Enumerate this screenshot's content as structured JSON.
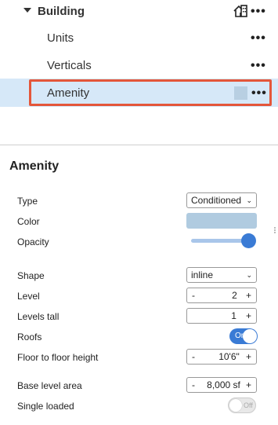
{
  "tree": {
    "parent": {
      "label": "Building"
    },
    "items": [
      {
        "label": "Units"
      },
      {
        "label": "Verticals"
      },
      {
        "label": "Amenity"
      }
    ],
    "more_glyph": "•••",
    "selected_color": "#b8cfe2",
    "highlight_color": "#e4563a",
    "row_bg": "#d6e8f8"
  },
  "panel": {
    "title": "Amenity",
    "type": {
      "label": "Type",
      "value": "Conditioned"
    },
    "color": {
      "label": "Color",
      "value": "#b0cbe0"
    },
    "opacity": {
      "label": "Opacity",
      "level": 0.95
    },
    "shape": {
      "label": "Shape",
      "value": "inline"
    },
    "level": {
      "label": "Level",
      "value": "2",
      "minus": "-",
      "plus": "+"
    },
    "levels_tall": {
      "label": "Levels tall",
      "value": "1",
      "plus": "+"
    },
    "roofs": {
      "label": "Roofs",
      "state": "On"
    },
    "floor_height": {
      "label": "Floor to floor height",
      "value": "10'6\"",
      "minus": "-",
      "plus": "+"
    },
    "base_area": {
      "label": "Base level area",
      "value": "8,000 sf",
      "minus": "-",
      "plus": "+"
    },
    "single_loaded": {
      "label": "Single loaded",
      "state": "Off"
    }
  },
  "colors": {
    "accent": "#3a7bd5"
  }
}
